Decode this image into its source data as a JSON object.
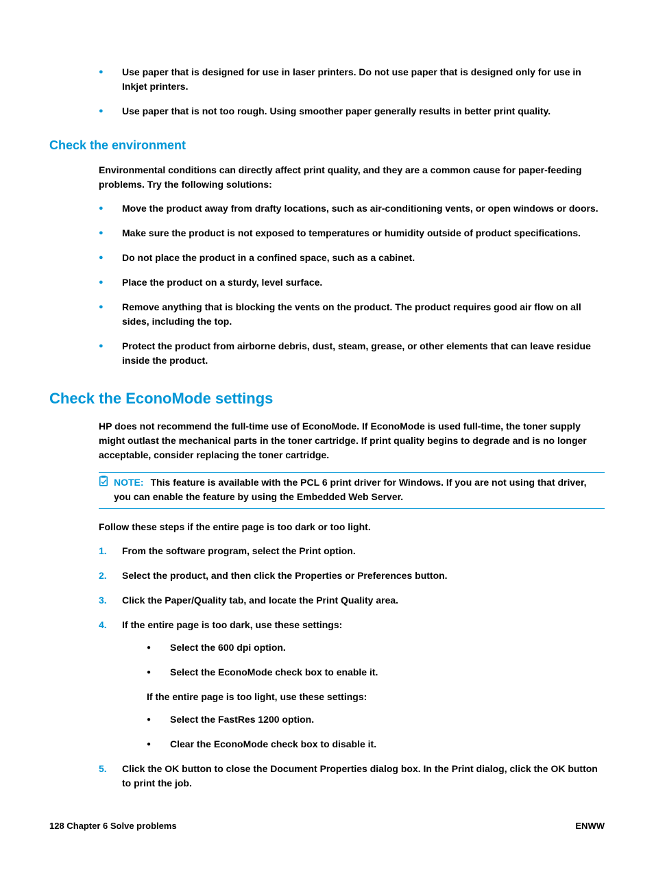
{
  "intro_bullets": [
    "Use paper that is designed for use in laser printers. Do not use paper that is designed only for use in Inkjet printers.",
    "Use paper that is not too rough. Using smoother paper generally results in better print quality."
  ],
  "env": {
    "heading": "Check the environment",
    "intro": "Environmental conditions can directly affect print quality, and they are a common cause for paper-feeding problems. Try the following solutions:",
    "bullets": [
      "Move the product away from drafty locations, such as air-conditioning vents, or open windows or doors.",
      "Make sure the product is not exposed to temperatures or humidity outside of product specifications.",
      "Do not place the product in a confined space, such as a cabinet.",
      "Place the product on a sturdy, level surface.",
      "Remove anything that is blocking the vents on the product. The product requires good air flow on all sides, including the top.",
      "Protect the product from airborne debris, dust, steam, grease, or other elements that can leave residue inside the product."
    ]
  },
  "econ": {
    "heading": "Check the EconoMode settings",
    "intro": "HP does not recommend the full-time use of EconoMode. If EconoMode is used full-time, the toner supply might outlast the mechanical parts in the toner cartridge. If print quality begins to degrade and is no longer acceptable, consider replacing the toner cartridge.",
    "note_label": "NOTE:",
    "note_text": "This feature is available with the PCL 6 print driver for Windows. If you are not using that driver, you can enable the feature by using the Embedded Web Server.",
    "follow": "Follow these steps if the entire page is too dark or too light.",
    "steps": {
      "s1_a": "From the software program, select the ",
      "s1_b": "Print",
      "s1_c": " option.",
      "s2_a": "Select the product, and then click the ",
      "s2_b": "Properties",
      "s2_c": " or ",
      "s2_d": "Preferences",
      "s2_e": " button.",
      "s3_a": "Click the ",
      "s3_b": "Paper/Quality",
      "s3_c": " tab, and locate the ",
      "s3_d": "Print Quality",
      "s3_e": " area.",
      "s4_intro": "If the entire page is too dark, use these settings:",
      "s4_b1_a": "Select the ",
      "s4_b1_b": "600 dpi",
      "s4_b1_c": " option.",
      "s4_b2_a": "Select the ",
      "s4_b2_b": "EconoMode",
      "s4_b2_c": " check box to enable it.",
      "s4_mid": "If the entire page is too light, use these settings:",
      "s4_b3_a": "Select the ",
      "s4_b3_b": "FastRes 1200",
      "s4_b3_c": " option.",
      "s4_b4_a": "Clear the ",
      "s4_b4_b": "EconoMode",
      "s4_b4_c": " check box to disable it.",
      "s5_a": "Click the ",
      "s5_b": "OK",
      "s5_c": " button to close the ",
      "s5_d": "Document Properties",
      "s5_e": " dialog box. In the ",
      "s5_f": "Print",
      "s5_g": " dialog, click the ",
      "s5_h": "OK",
      "s5_i": " button to print the job."
    }
  },
  "footer": {
    "left": "128   Chapter 6   Solve problems",
    "right": "ENWW"
  }
}
